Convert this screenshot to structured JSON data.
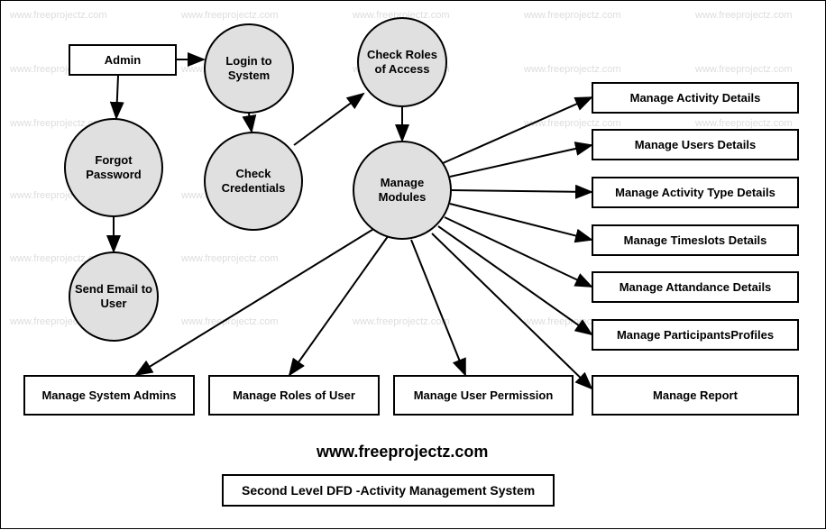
{
  "watermark_text": "www.freeprojectz.com",
  "entities": {
    "admin": "Admin",
    "login": "Login to System",
    "forgot": "Forgot Password",
    "check_cred": "Check Credentials",
    "check_roles": "Check Roles of Access",
    "send_email": "Send Email to User",
    "manage_modules": "Manage Modules"
  },
  "outputs": {
    "activity_details": "Manage Activity Details",
    "users_details": "Manage Users Details",
    "activity_type": "Manage Activity Type Details",
    "timeslots": "Manage Timeslots Details",
    "attendance": "Manage Attandance Details",
    "participants": "Manage ParticipantsProfiles",
    "report": "Manage  Report",
    "system_admins": "Manage System Admins",
    "roles_user": "Manage Roles of User",
    "user_permission": "Manage User Permission"
  },
  "footer_url": "www.freeprojectz.com",
  "title": "Second Level DFD -Activity Management System"
}
